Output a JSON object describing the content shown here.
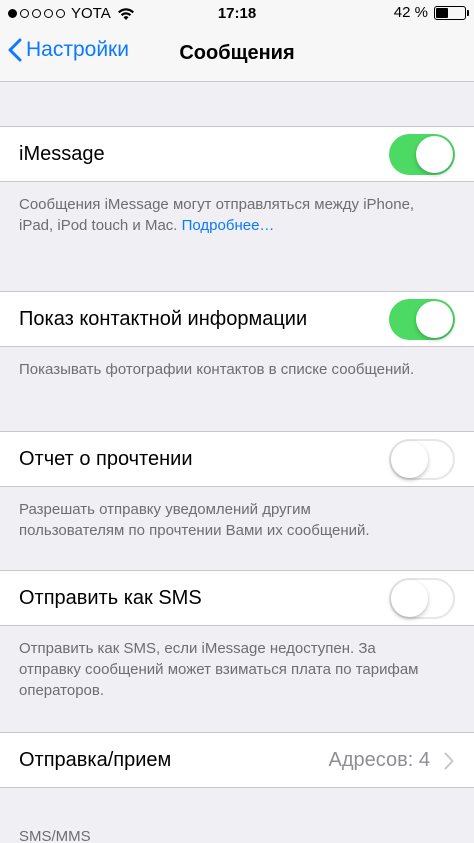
{
  "status_bar": {
    "carrier": "YOTA",
    "time": "17:18",
    "battery": "42 %",
    "battery_level": 0.42,
    "signal_bars_filled": 1,
    "signal_bars_total": 5
  },
  "nav": {
    "back_label": "Настройки",
    "title": "Сообщения"
  },
  "colors": {
    "accent": "#0a7aff",
    "switch_on": "#4cd964",
    "background": "#efeff4"
  },
  "settings": {
    "imessage": {
      "label": "iMessage",
      "on": true,
      "footer": "Сообщения iMessage могут отправляться между iPhone, iPad, iPod touch и Mac.",
      "footer_link": "Подробнее…"
    },
    "show_contact": {
      "label": "Показ контактной информации",
      "on": true,
      "footer": "Показывать фотографии контактов в списке сообщений."
    },
    "read_receipts": {
      "label": "Отчет о прочтении",
      "on": false,
      "footer": "Разрешать отправку уведомлений другим пользователям по прочтении Вами их сообщений."
    },
    "send_as_sms": {
      "label": "Отправить как SMS",
      "on": false,
      "footer": "Отправить как SMS, если iMessage недоступен. За отправку сообщений может взиматься плата по тарифам операторов."
    },
    "send_receive": {
      "label": "Отправка/прием",
      "value": "Адресов: 4"
    }
  },
  "section_header": "SMS/MMS"
}
